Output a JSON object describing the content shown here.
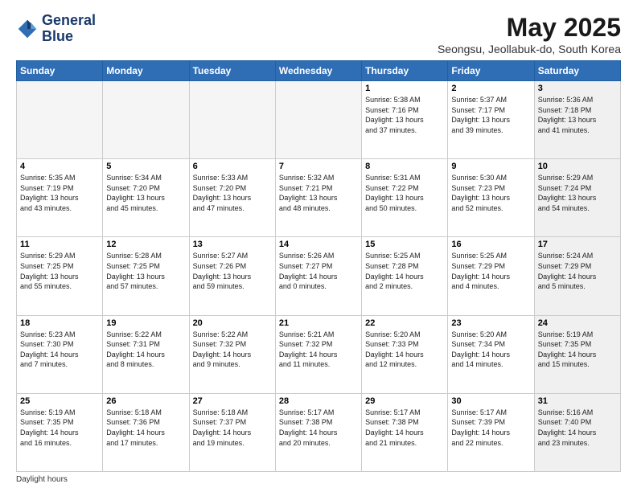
{
  "logo": {
    "line1": "General",
    "line2": "Blue"
  },
  "title": "May 2025",
  "location": "Seongsu, Jeollabuk-do, South Korea",
  "days_of_week": [
    "Sunday",
    "Monday",
    "Tuesday",
    "Wednesday",
    "Thursday",
    "Friday",
    "Saturday"
  ],
  "footer_text": "Daylight hours",
  "weeks": [
    [
      {
        "day": "",
        "info": "",
        "empty": true
      },
      {
        "day": "",
        "info": "",
        "empty": true
      },
      {
        "day": "",
        "info": "",
        "empty": true
      },
      {
        "day": "",
        "info": "",
        "empty": true
      },
      {
        "day": "1",
        "info": "Sunrise: 5:38 AM\nSunset: 7:16 PM\nDaylight: 13 hours\nand 37 minutes.",
        "empty": false
      },
      {
        "day": "2",
        "info": "Sunrise: 5:37 AM\nSunset: 7:17 PM\nDaylight: 13 hours\nand 39 minutes.",
        "empty": false
      },
      {
        "day": "3",
        "info": "Sunrise: 5:36 AM\nSunset: 7:18 PM\nDaylight: 13 hours\nand 41 minutes.",
        "empty": false,
        "shaded": true
      }
    ],
    [
      {
        "day": "4",
        "info": "Sunrise: 5:35 AM\nSunset: 7:19 PM\nDaylight: 13 hours\nand 43 minutes.",
        "empty": false
      },
      {
        "day": "5",
        "info": "Sunrise: 5:34 AM\nSunset: 7:20 PM\nDaylight: 13 hours\nand 45 minutes.",
        "empty": false
      },
      {
        "day": "6",
        "info": "Sunrise: 5:33 AM\nSunset: 7:20 PM\nDaylight: 13 hours\nand 47 minutes.",
        "empty": false
      },
      {
        "day": "7",
        "info": "Sunrise: 5:32 AM\nSunset: 7:21 PM\nDaylight: 13 hours\nand 48 minutes.",
        "empty": false
      },
      {
        "day": "8",
        "info": "Sunrise: 5:31 AM\nSunset: 7:22 PM\nDaylight: 13 hours\nand 50 minutes.",
        "empty": false
      },
      {
        "day": "9",
        "info": "Sunrise: 5:30 AM\nSunset: 7:23 PM\nDaylight: 13 hours\nand 52 minutes.",
        "empty": false
      },
      {
        "day": "10",
        "info": "Sunrise: 5:29 AM\nSunset: 7:24 PM\nDaylight: 13 hours\nand 54 minutes.",
        "empty": false,
        "shaded": true
      }
    ],
    [
      {
        "day": "11",
        "info": "Sunrise: 5:29 AM\nSunset: 7:25 PM\nDaylight: 13 hours\nand 55 minutes.",
        "empty": false
      },
      {
        "day": "12",
        "info": "Sunrise: 5:28 AM\nSunset: 7:25 PM\nDaylight: 13 hours\nand 57 minutes.",
        "empty": false
      },
      {
        "day": "13",
        "info": "Sunrise: 5:27 AM\nSunset: 7:26 PM\nDaylight: 13 hours\nand 59 minutes.",
        "empty": false
      },
      {
        "day": "14",
        "info": "Sunrise: 5:26 AM\nSunset: 7:27 PM\nDaylight: 14 hours\nand 0 minutes.",
        "empty": false
      },
      {
        "day": "15",
        "info": "Sunrise: 5:25 AM\nSunset: 7:28 PM\nDaylight: 14 hours\nand 2 minutes.",
        "empty": false
      },
      {
        "day": "16",
        "info": "Sunrise: 5:25 AM\nSunset: 7:29 PM\nDaylight: 14 hours\nand 4 minutes.",
        "empty": false
      },
      {
        "day": "17",
        "info": "Sunrise: 5:24 AM\nSunset: 7:29 PM\nDaylight: 14 hours\nand 5 minutes.",
        "empty": false,
        "shaded": true
      }
    ],
    [
      {
        "day": "18",
        "info": "Sunrise: 5:23 AM\nSunset: 7:30 PM\nDaylight: 14 hours\nand 7 minutes.",
        "empty": false
      },
      {
        "day": "19",
        "info": "Sunrise: 5:22 AM\nSunset: 7:31 PM\nDaylight: 14 hours\nand 8 minutes.",
        "empty": false
      },
      {
        "day": "20",
        "info": "Sunrise: 5:22 AM\nSunset: 7:32 PM\nDaylight: 14 hours\nand 9 minutes.",
        "empty": false
      },
      {
        "day": "21",
        "info": "Sunrise: 5:21 AM\nSunset: 7:32 PM\nDaylight: 14 hours\nand 11 minutes.",
        "empty": false
      },
      {
        "day": "22",
        "info": "Sunrise: 5:20 AM\nSunset: 7:33 PM\nDaylight: 14 hours\nand 12 minutes.",
        "empty": false
      },
      {
        "day": "23",
        "info": "Sunrise: 5:20 AM\nSunset: 7:34 PM\nDaylight: 14 hours\nand 14 minutes.",
        "empty": false
      },
      {
        "day": "24",
        "info": "Sunrise: 5:19 AM\nSunset: 7:35 PM\nDaylight: 14 hours\nand 15 minutes.",
        "empty": false,
        "shaded": true
      }
    ],
    [
      {
        "day": "25",
        "info": "Sunrise: 5:19 AM\nSunset: 7:35 PM\nDaylight: 14 hours\nand 16 minutes.",
        "empty": false
      },
      {
        "day": "26",
        "info": "Sunrise: 5:18 AM\nSunset: 7:36 PM\nDaylight: 14 hours\nand 17 minutes.",
        "empty": false
      },
      {
        "day": "27",
        "info": "Sunrise: 5:18 AM\nSunset: 7:37 PM\nDaylight: 14 hours\nand 19 minutes.",
        "empty": false
      },
      {
        "day": "28",
        "info": "Sunrise: 5:17 AM\nSunset: 7:38 PM\nDaylight: 14 hours\nand 20 minutes.",
        "empty": false
      },
      {
        "day": "29",
        "info": "Sunrise: 5:17 AM\nSunset: 7:38 PM\nDaylight: 14 hours\nand 21 minutes.",
        "empty": false
      },
      {
        "day": "30",
        "info": "Sunrise: 5:17 AM\nSunset: 7:39 PM\nDaylight: 14 hours\nand 22 minutes.",
        "empty": false
      },
      {
        "day": "31",
        "info": "Sunrise: 5:16 AM\nSunset: 7:40 PM\nDaylight: 14 hours\nand 23 minutes.",
        "empty": false,
        "shaded": true
      }
    ]
  ]
}
